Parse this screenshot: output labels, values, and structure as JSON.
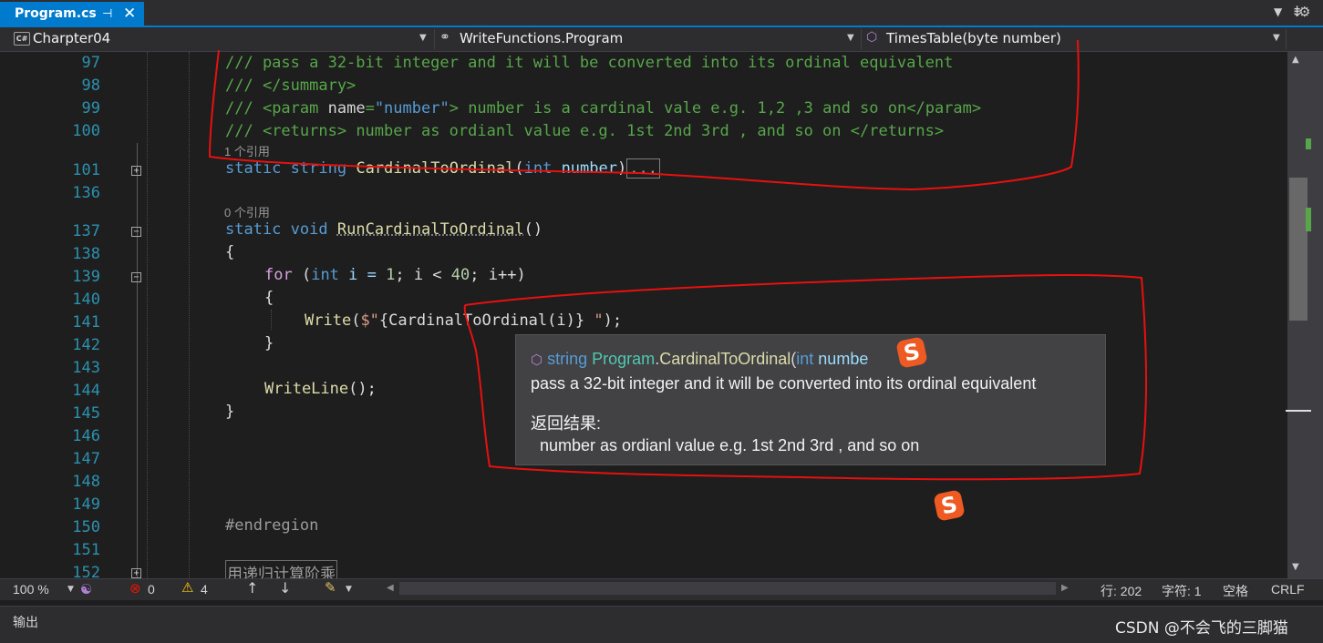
{
  "tab": {
    "title": "Program.cs",
    "pin_glyph": "⊣",
    "close_glyph": "✕"
  },
  "nav": {
    "project": "Charpter04",
    "type": "WriteFunctions.Program",
    "member": "TimesTable(byte number)"
  },
  "editor": {
    "line_numbers": [
      "97",
      "98",
      "99",
      "100",
      "101",
      "136",
      "137",
      "138",
      "139",
      "140",
      "141",
      "142",
      "143",
      "144",
      "145",
      "146",
      "147",
      "148",
      "149",
      "150",
      "151",
      "152"
    ],
    "lens_1": "1 个引用",
    "lens_0": "0 个引用",
    "doc": {
      "l97": "/// pass a 32-bit integer and it will be converted into its ordinal equivalent",
      "l98": "/// </summary>",
      "l99_a": "/// ",
      "l99_tag": "<param ",
      "l99_attr": "name",
      "l99_eq": "=",
      "l99_val": "\"number\"",
      "l99_close": ">",
      "l99_text": " number is a cardinal vale e.g. 1,2 ,3 and so on",
      "l99_end": "</param>",
      "l100_a": "/// ",
      "l100_tag": "<returns>",
      "l100_text": " number as ordianl value e.g. 1st 2nd 3rd , and so on ",
      "l100_end": "</returns>"
    },
    "code": {
      "static": "static",
      "string": "string",
      "void": "void",
      "int": "int",
      "for": "for",
      "method1": "CardinalToOrdinal",
      "param": "number",
      "collapsed": "...",
      "method2": "RunCardinalToOrdinal",
      "paren_open": "(",
      "paren_close": ")",
      "parens": "()",
      "brace_open": "{",
      "brace_close": "}",
      "for_a": " (",
      "for_i1": " i = ",
      "for_one": "1",
      "for_b": "; i < ",
      "for_forty": "40",
      "for_c": "; i++)",
      "write": "Write",
      "write_a": "(",
      "write_str1": "$\"",
      "write_interp": "{CardinalToOrdinal(i)}",
      "write_str2": " \"",
      "write_end": ");",
      "writeline": "WriteLine",
      "writeline_end": "();",
      "endregion": "#endregion",
      "l152": "用递归计算阶乘"
    }
  },
  "quickinfo": {
    "sig_string": "string",
    "sig_class": "Program",
    "sig_dot": ".",
    "sig_method": "CardinalToOrdinal",
    "sig_paren": "(",
    "sig_int": "int",
    "sig_param": " numbe",
    "summary": "pass a 32-bit integer and it will be converted into its ordinal equivalent",
    "returns_label": "返回结果:",
    "returns_text": "number as ordianl value e.g. 1st 2nd 3rd , and so on"
  },
  "status": {
    "zoom": "100 %",
    "errors": "0",
    "warnings": "4",
    "line": "行: 202",
    "char": "字符: 1",
    "spaces": "空格",
    "eol": "CRLF"
  },
  "output": {
    "title": "输出"
  },
  "watermark": "CSDN @不会飞的三脚猫",
  "sogou_glyph": "S",
  "colors": {
    "accent": "#007acc",
    "annotation": "#e81010",
    "sogou": "#ef5a22"
  }
}
